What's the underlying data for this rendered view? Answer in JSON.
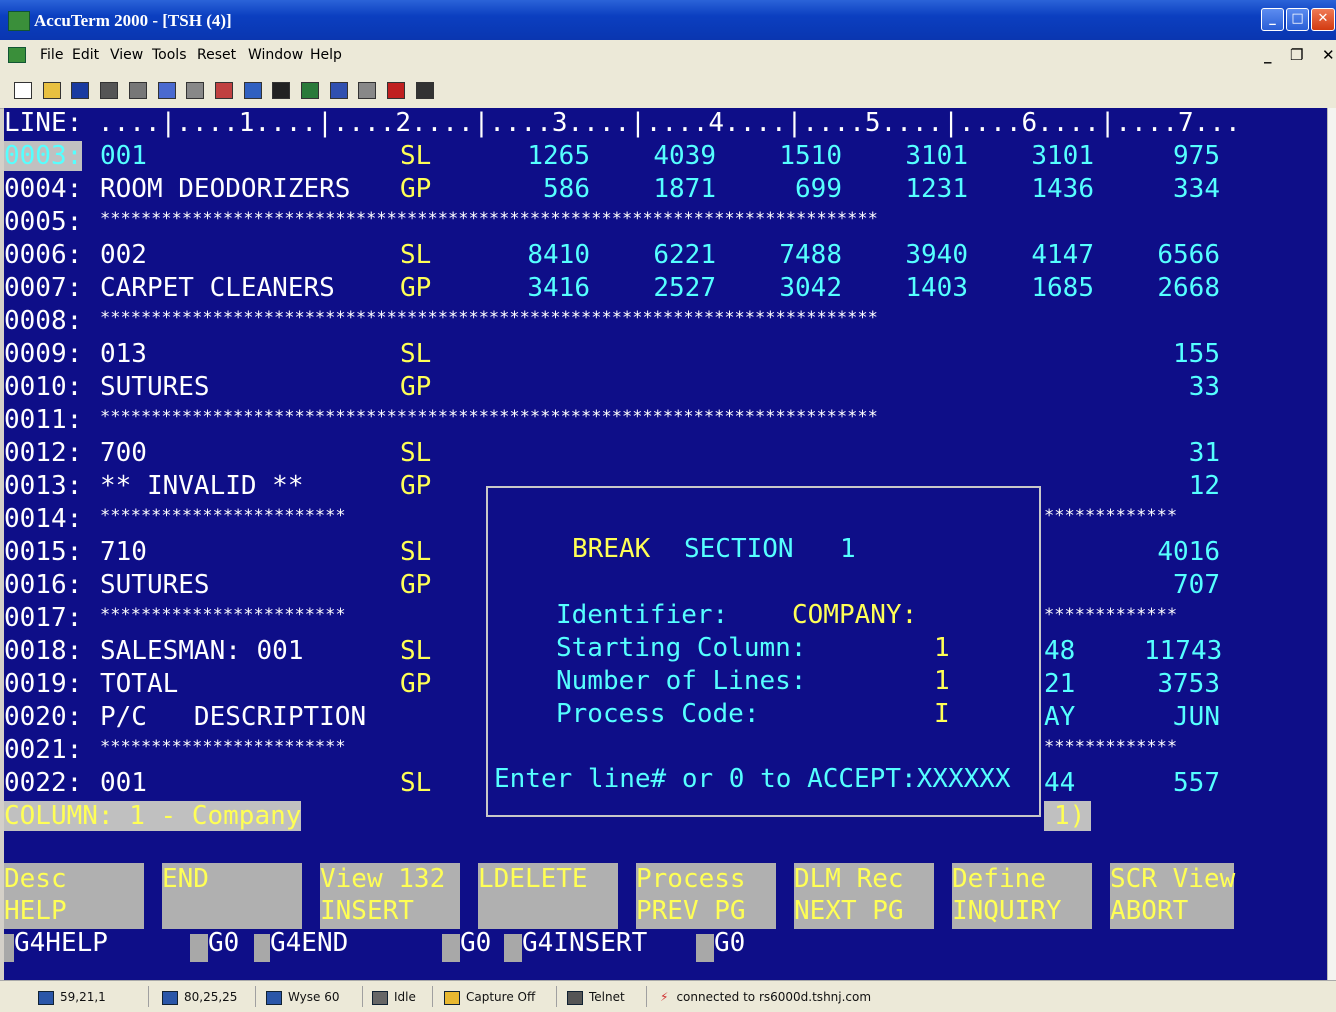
{
  "window": {
    "title": "AccuTerm 2000 - [TSH (4)]"
  },
  "menu": [
    "File",
    "Edit",
    "View",
    "Tools",
    "Reset",
    "Window",
    "Help"
  ],
  "toolbar_icons": [
    "new-icon",
    "open-icon",
    "save-icon",
    "print-icon",
    "capture-icon",
    "copy-icon",
    "paste-icon",
    "send-icon",
    "receive-icon",
    "disconnect-icon",
    "settings-icon",
    "keyboard-icon",
    "macro-icon",
    "script-icon",
    "help-icon"
  ],
  "ruler": "LINE: ....|....1....|....2....|....3....|....4....|....5....|....6....|....7...",
  "rows": [
    {
      "num": "0003:",
      "desc": "001",
      "type": "SL",
      "vals": [
        "1265",
        "4039",
        "1510",
        "3101",
        "3101",
        "975"
      ],
      "highlight": true
    },
    {
      "num": "0004:",
      "desc": "ROOM DEODORIZERS",
      "type": "GP",
      "vals": [
        "586",
        "1871",
        "699",
        "1231",
        "1436",
        "334"
      ]
    },
    {
      "num": "0005:",
      "stars": true
    },
    {
      "num": "0006:",
      "desc": "002",
      "type": "SL",
      "vals": [
        "8410",
        "6221",
        "7488",
        "3940",
        "4147",
        "6566"
      ]
    },
    {
      "num": "0007:",
      "desc": "CARPET CLEANERS",
      "type": "GP",
      "vals": [
        "3416",
        "2527",
        "3042",
        "1403",
        "1685",
        "2668"
      ]
    },
    {
      "num": "0008:",
      "stars": true
    },
    {
      "num": "0009:",
      "desc": "013",
      "type": "SL",
      "vals": [
        "",
        "",
        "",
        "",
        "",
        "155"
      ]
    },
    {
      "num": "0010:",
      "desc": "SUTURES",
      "type": "GP",
      "vals": [
        "",
        "",
        "",
        "",
        "",
        "33"
      ]
    },
    {
      "num": "0011:",
      "stars": true
    },
    {
      "num": "0012:",
      "desc": "700",
      "type": "SL",
      "vals": [
        "",
        "",
        "",
        "",
        "",
        "31"
      ]
    },
    {
      "num": "0013:",
      "desc": "** INVALID **",
      "type": "GP",
      "vals": [
        "",
        "",
        "",
        "",
        "",
        "12"
      ]
    },
    {
      "num": "0014:",
      "stars": true,
      "partial": true
    },
    {
      "num": "0015:",
      "desc": "710",
      "type": "SL",
      "vals": [
        "",
        "",
        "",
        "",
        "",
        "4016"
      ]
    },
    {
      "num": "0016:",
      "desc": "SUTURES",
      "type": "GP",
      "vals": [
        "",
        "",
        "",
        "",
        "",
        "707"
      ]
    },
    {
      "num": "0017:",
      "stars": true,
      "partial": true
    },
    {
      "num": "0018:",
      "desc": "SALESMAN: 001",
      "type": "SL",
      "vals": [
        "",
        "",
        "",
        "",
        "48",
        "11743"
      ]
    },
    {
      "num": "0019:",
      "desc": "TOTAL",
      "type": "GP",
      "vals": [
        "",
        "",
        "",
        "",
        "21",
        "3753"
      ]
    },
    {
      "num": "0020:",
      "desc": "P/C   DESCRIPTION",
      "type": "",
      "vals": [
        "",
        "",
        "",
        "",
        "AY",
        "JUN"
      ]
    },
    {
      "num": "0021:",
      "stars": true,
      "partial": true
    },
    {
      "num": "0022:",
      "desc": "001",
      "type": "SL",
      "vals": [
        "",
        "",
        "",
        "",
        "44",
        "557"
      ]
    }
  ],
  "stars_full": "****************************************************************************",
  "stars_left": "************************",
  "stars_right": "*************",
  "column_status": "COLUMN: 1 - Company",
  "column_right": "1)",
  "dialog": {
    "heading_break": "BREAK",
    "heading_section": "SECTION",
    "heading_num": "1",
    "identifier_label": "Identifier:",
    "identifier_value": "COMPANY:",
    "start_label": "Starting Column:",
    "start_value": "1",
    "lines_label": "Number of Lines:",
    "lines_value": "1",
    "process_label": "Process Code:",
    "process_value": "I",
    "prompt": "Enter line# or 0 to ACCEPT:XXXXXX"
  },
  "fkeys": [
    {
      "top": "Desc",
      "bottom": "HELP"
    },
    {
      "top": "",
      "bottom": "END"
    },
    {
      "top": "View 132",
      "bottom": "INSERT"
    },
    {
      "top": "",
      "bottom": "LDELETE"
    },
    {
      "top": "Process",
      "bottom": "PREV PG"
    },
    {
      "top": "DLM Rec",
      "bottom": "NEXT PG"
    },
    {
      "top": "Define",
      "bottom": "INQUIRY"
    },
    {
      "top": "SCR View",
      "bottom": "ABORT"
    }
  ],
  "g4_line": {
    "a": "G4HELP",
    "b": "G0",
    "c": "G4END",
    "d": "G0",
    "e": "G4INSERT",
    "f": "G0"
  },
  "status": {
    "cursor": "59,21,1",
    "size": "80,25,25",
    "emulation": "Wyse 60",
    "printer": "Idle",
    "capture": "Capture Off",
    "protocol": "Telnet",
    "connection": "connected to rs6000d.tshnj.com"
  }
}
